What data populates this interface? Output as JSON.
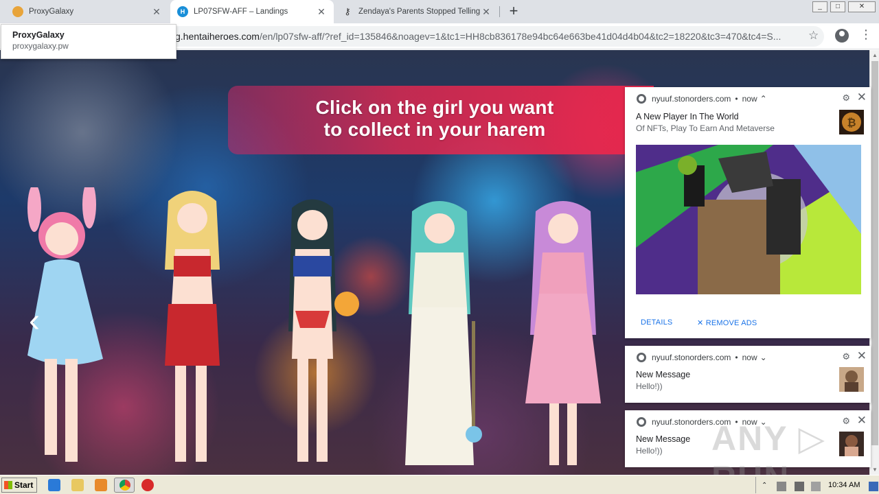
{
  "tabs": [
    {
      "title": "ProxyGalaxy",
      "favicon": "proxygalaxy-icon",
      "color": "#e8a43a"
    },
    {
      "title": "LP07SFW-AFF – Landings",
      "favicon": "hentaiheroes-icon",
      "color": "#1a8fd8"
    },
    {
      "title": "Zendaya's Parents Stopped Telling H",
      "favicon": "key-icon",
      "color": "#333333"
    }
  ],
  "window_buttons": [
    "_",
    "□",
    "✕"
  ],
  "address": {
    "host": "g.hentaiheroes.com",
    "path": "/en/lp07sfw-aff/?ref_id=135846&noagev=1&tc1=HH8cb836178e94bc64e663be41d04d4b04&tc2=18220&tc3=470&tc4=S..."
  },
  "tooltip": {
    "title": "ProxyGalaxy",
    "subtitle": "proxygalaxy.pw"
  },
  "banner": {
    "line1": "Click on the girl you want",
    "line2": "to collect in your harem"
  },
  "notifications": [
    {
      "site": "nyuuf.stonorders.com",
      "time": "now",
      "caret": "⌃",
      "title": "A New Player In The World",
      "body": "Of NFTs, Play To Earn And Metaverse",
      "actions": {
        "details": "DETAILS",
        "remove": "REMOVE ADS"
      }
    },
    {
      "site": "nyuuf.stonorders.com",
      "time": "now",
      "caret": "⌄",
      "title": "New Message",
      "body": "Hello!))"
    },
    {
      "site": "nyuuf.stonorders.com",
      "time": "now",
      "caret": "⌄",
      "title": "New Message",
      "body": "Hello!))"
    }
  ],
  "taskbar": {
    "start": "Start",
    "clock": "10:34 AM"
  },
  "watermark": "ANY RUN"
}
